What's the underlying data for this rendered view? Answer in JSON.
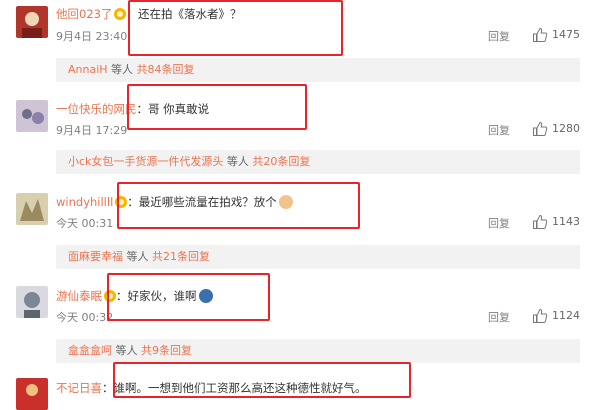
{
  "comments": [
    {
      "username": "他回023了",
      "has_badge": true,
      "colon": "：",
      "text": "还在拍《落水者》？",
      "time": "9月4日 23:40",
      "reply": "回复",
      "likes": "1475",
      "subreply": {
        "user": "AnnaiH",
        "middle": "等人",
        "link": "共84条回复"
      },
      "avatar_colors": [
        "#b0362c",
        "#f0d7b6"
      ]
    },
    {
      "username": "一位快乐的网民",
      "has_badge": false,
      "colon": "：",
      "text": "哥 你真敢说",
      "time": "9月4日 17:29",
      "reply": "回复",
      "likes": "1280",
      "subreply": {
        "user": "小ck女包一手货源一件代发源头",
        "middle": "等人",
        "link": "共20条回复"
      },
      "avatar_colors": [
        "#6c6f8a",
        "#cfc3d6"
      ]
    },
    {
      "username": "windyhillll",
      "has_badge": true,
      "colon": "：",
      "text": "最近哪些流量在拍戏？放个",
      "emoji": "ear-emoji",
      "time": "今天 00:31",
      "reply": "回复",
      "likes": "1143",
      "subreply": {
        "user": "面麻要幸福",
        "middle": "等人",
        "link": "共21条回复"
      },
      "avatar_colors": [
        "#9b8a5e",
        "#d8cfae"
      ]
    },
    {
      "username": "游仙泰眠",
      "has_badge": true,
      "colon": "：",
      "text": "好家伙，谁啊",
      "emoji": "face-emoji",
      "time": "今天 00:32",
      "reply": "回复",
      "likes": "1124",
      "subreply": {
        "user": "盒盒盒呵",
        "middle": "等人",
        "link": "共9条回复"
      },
      "avatar_colors": [
        "#7b8794",
        "#d9d9df"
      ]
    },
    {
      "username": "不记日喜",
      "has_badge": false,
      "colon": "：",
      "text": "谁啊。一想到他们工资那么高还这种德性就好气。",
      "avatar_colors": [
        "#c9302c",
        "#f1c27d"
      ]
    }
  ],
  "colors": {
    "username": "#eb7350",
    "highlight_box": "#e8242b",
    "subbar_bg": "#f2f2f2"
  },
  "icons": {
    "like": "thumbs-up-icon",
    "badge": "vip-badge-icon"
  }
}
